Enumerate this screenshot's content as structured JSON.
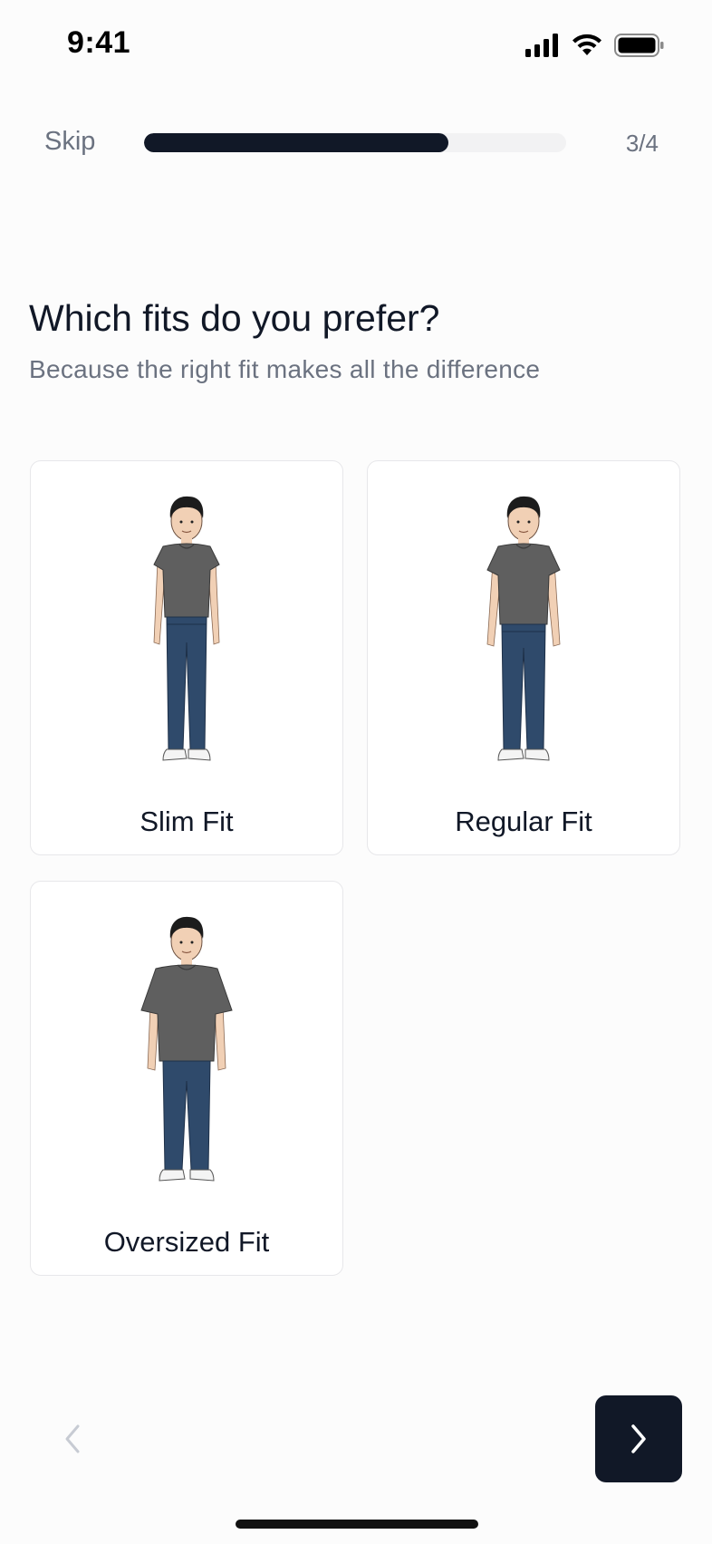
{
  "status_bar": {
    "time": "9:41",
    "icons": [
      "cellular-signal-icon",
      "wifi-icon",
      "battery-icon"
    ]
  },
  "header": {
    "skip_label": "Skip",
    "progress": {
      "current": 3,
      "total": 4,
      "fill_fraction": 0.72
    },
    "step_counter": "3/4"
  },
  "question": {
    "title": "Which fits do you prefer?",
    "subtitle": "Because the right fit makes all the difference"
  },
  "options": [
    {
      "label": "Slim Fit",
      "icon": "slim-fit-figure-icon"
    },
    {
      "label": "Regular Fit",
      "icon": "regular-fit-figure-icon"
    },
    {
      "label": "Oversized Fit",
      "icon": "oversized-fit-figure-icon"
    }
  ],
  "navigation": {
    "back_icon": "chevron-left-icon",
    "next_icon": "chevron-right-icon"
  },
  "colors": {
    "primary": "#111827",
    "muted_text": "#6b7280",
    "track": "#f2f2f3",
    "card_border": "#e7e7ea",
    "shirt": "#5f5f5f",
    "jeans": "#2f4a6b",
    "skin": "#f1d0b5"
  }
}
